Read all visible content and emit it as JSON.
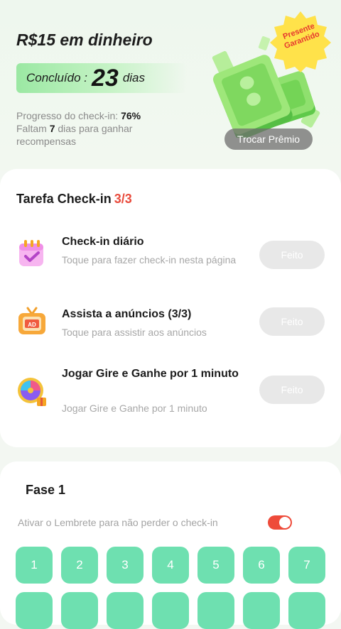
{
  "hero": {
    "reward": "R$15 em dinheiro",
    "done_label": "Concluído :",
    "done_days": "23",
    "done_unit": "dias",
    "progress_label": "Progresso do check-in: ",
    "progress_value": "76%",
    "remaining_prefix": "Faltam ",
    "remaining_days": "7",
    "remaining_suffix": " dias para ganhar recompensas",
    "badge_line1": "Presente",
    "badge_line2": "Garantido",
    "trade_button": "Trocar Prêmio"
  },
  "tasks": {
    "title": "Tarefa Check-in",
    "count": "3/3",
    "items": [
      {
        "title": "Check-in diário",
        "subtitle": "Toque para fazer check-in nesta página",
        "button": "Feito",
        "icon": "calendar-icon"
      },
      {
        "title": "Assista a anúncios  (3/3)",
        "subtitle": "Toque para assistir aos anúncios",
        "button": "Feito",
        "icon": "tv-ad-icon"
      },
      {
        "title": "Jogar Gire e Ganhe por 1 minuto",
        "subtitle": "Jogar Gire e Ganhe por 1 minuto",
        "button": "Feito",
        "icon": "prize-wheel-icon"
      }
    ]
  },
  "phase": {
    "title": "Fase 1",
    "reminder": "Ativar o Lembrete para não perder o check-in",
    "reminder_on": true,
    "days": [
      "1",
      "2",
      "3",
      "4",
      "5",
      "6",
      "7"
    ]
  },
  "colors": {
    "accent": "#ee4b3a",
    "day_tile": "#6ee0b0",
    "pill": "#9be8a3"
  }
}
